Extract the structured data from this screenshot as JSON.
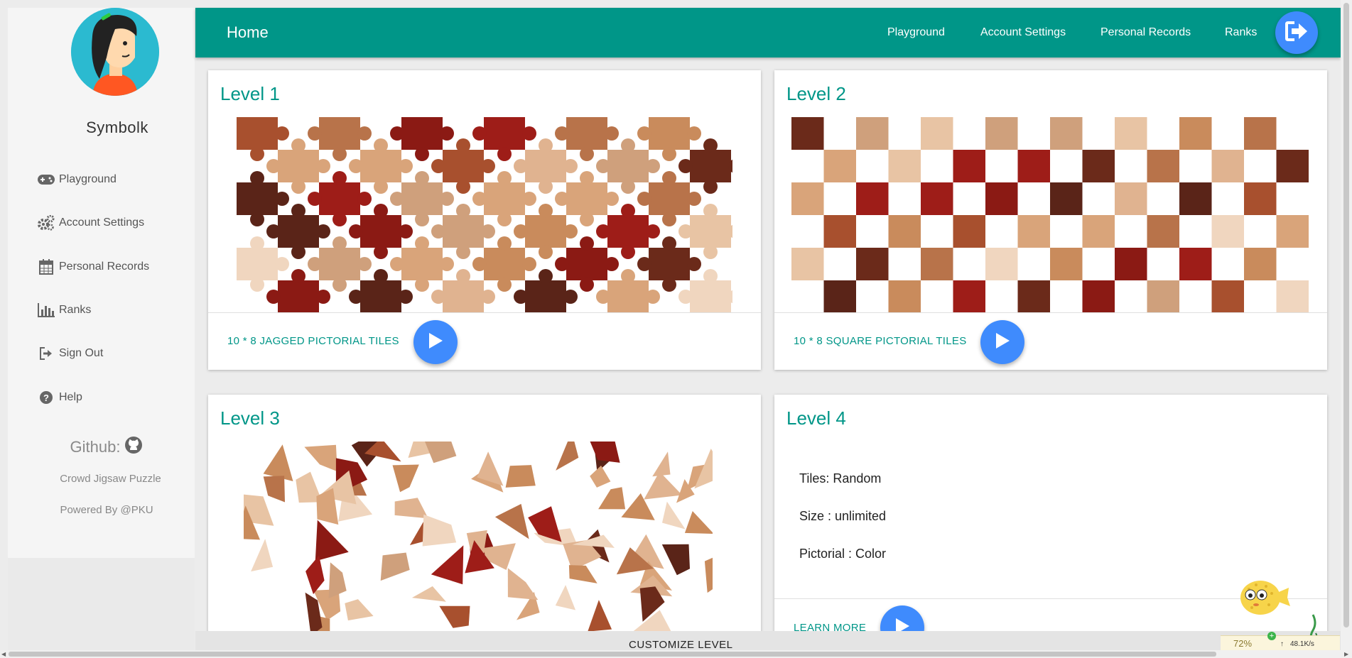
{
  "sidebar": {
    "username": "Symbolk",
    "items": [
      {
        "label": "Playground",
        "icon": "gamepad-icon"
      },
      {
        "label": "Account Settings",
        "icon": "gears-icon"
      },
      {
        "label": "Personal Records",
        "icon": "calendar-icon"
      },
      {
        "label": "Ranks",
        "icon": "bar-chart-icon"
      },
      {
        "label": "Sign Out",
        "icon": "sign-out-icon"
      },
      {
        "label": "Help",
        "icon": "question-circle-icon"
      }
    ],
    "github_label": "Github:",
    "crowd_link": "Crowd Jigsaw Puzzle",
    "powered_by": "Powered By @PKU"
  },
  "header": {
    "title": "Home",
    "nav": [
      "Playground",
      "Account Settings",
      "Personal Records",
      "Ranks"
    ],
    "colors": {
      "primary": "#009688",
      "accent": "#3f8bfd"
    }
  },
  "levels": [
    {
      "title": "Level 1",
      "action": "10 * 8 JAGGED PICTORIAL TILES"
    },
    {
      "title": "Level 2",
      "action": "10 * 8 SQUARE PICTORIAL TILES"
    },
    {
      "title": "Level 3"
    },
    {
      "title": "Level 4",
      "info": [
        "Tiles: Random",
        "Size : unlimited",
        "Pictorial : Color"
      ],
      "action": "LEARN MORE"
    }
  ],
  "footer": {
    "customize": "CUSTOMIZE LEVEL"
  },
  "widget": {
    "percent": "72%",
    "speed": "48.1K/s"
  }
}
